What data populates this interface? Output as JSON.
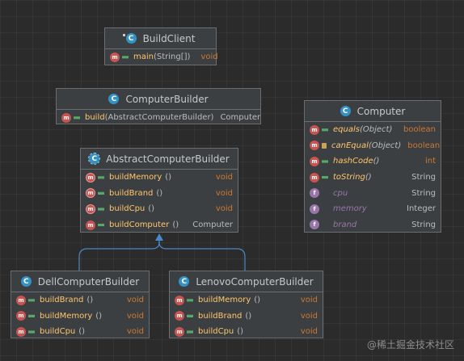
{
  "nodes": {
    "build_client": {
      "title": "BuildClient",
      "methods": [
        {
          "name": "main",
          "params": "(String[])",
          "type": "void",
          "type_kind": "kw",
          "icon": "m"
        }
      ]
    },
    "computer_builder": {
      "title": "ComputerBuilder",
      "methods": [
        {
          "name": "build",
          "params": "(AbstractComputerBuilder)",
          "type": "Computer",
          "type_kind": "cls",
          "icon": "m"
        }
      ]
    },
    "abstract_computer_builder": {
      "title": "AbstractComputerBuilder",
      "methods": [
        {
          "name": "buildMemory",
          "params": "()",
          "type": "void",
          "type_kind": "kw",
          "icon": "a"
        },
        {
          "name": "buildBrand",
          "params": "()",
          "type": "void",
          "type_kind": "kw",
          "icon": "a"
        },
        {
          "name": "buildCpu",
          "params": "()",
          "type": "void",
          "type_kind": "kw",
          "icon": "a"
        },
        {
          "name": "buildComputer",
          "params": "()",
          "type": "Computer",
          "type_kind": "cls",
          "icon": "m"
        }
      ]
    },
    "computer": {
      "title": "Computer",
      "methods": [
        {
          "name": "equals",
          "params": "(Object)",
          "type": "boolean",
          "type_kind": "kw",
          "icon": "m",
          "italic": true
        },
        {
          "name": "canEqual",
          "params": "(Object)",
          "type": "boolean",
          "type_kind": "kw",
          "icon": "m",
          "italic": true
        },
        {
          "name": "hashCode",
          "params": "()",
          "type": "int",
          "type_kind": "kw",
          "icon": "m",
          "italic": true
        },
        {
          "name": "toString",
          "params": "()",
          "type": "String",
          "type_kind": "cls",
          "icon": "m",
          "italic": true
        },
        {
          "name": "cpu",
          "params": "",
          "type": "String",
          "type_kind": "cls",
          "icon": "f",
          "field": true
        },
        {
          "name": "memory",
          "params": "",
          "type": "Integer",
          "type_kind": "cls",
          "icon": "f",
          "field": true
        },
        {
          "name": "brand",
          "params": "",
          "type": "String",
          "type_kind": "cls",
          "icon": "f",
          "field": true
        }
      ]
    },
    "dell_computer_builder": {
      "title": "DellComputerBuilder",
      "methods": [
        {
          "name": "buildBrand",
          "params": "()",
          "type": "void",
          "type_kind": "kw",
          "icon": "m"
        },
        {
          "name": "buildMemory",
          "params": "()",
          "type": "void",
          "type_kind": "kw",
          "icon": "m"
        },
        {
          "name": "buildCpu",
          "params": "()",
          "type": "void",
          "type_kind": "kw",
          "icon": "m"
        }
      ]
    },
    "lenovo_computer_builder": {
      "title": "LenovoComputerBuilder",
      "methods": [
        {
          "name": "buildMemory",
          "params": "()",
          "type": "void",
          "type_kind": "kw",
          "icon": "m"
        },
        {
          "name": "buildBrand",
          "params": "()",
          "type": "void",
          "type_kind": "kw",
          "icon": "m"
        },
        {
          "name": "buildCpu",
          "params": "()",
          "type": "void",
          "type_kind": "kw",
          "icon": "m"
        }
      ]
    }
  },
  "edges": [
    {
      "from": "dell_computer_builder",
      "to": "abstract_computer_builder",
      "kind": "extends"
    },
    {
      "from": "lenovo_computer_builder",
      "to": "abstract_computer_builder",
      "kind": "extends"
    }
  ],
  "watermark": "@稀土掘金技术社区",
  "colors": {
    "background": "#2b2b2b",
    "node_fill": "#3c3f41",
    "node_border": "#6a6e70",
    "method_name": "#ffc66d",
    "keyword_type": "#cc7832",
    "field_name": "#9876aa",
    "class_icon": "#3592c4",
    "edge": "#4a88c7"
  }
}
